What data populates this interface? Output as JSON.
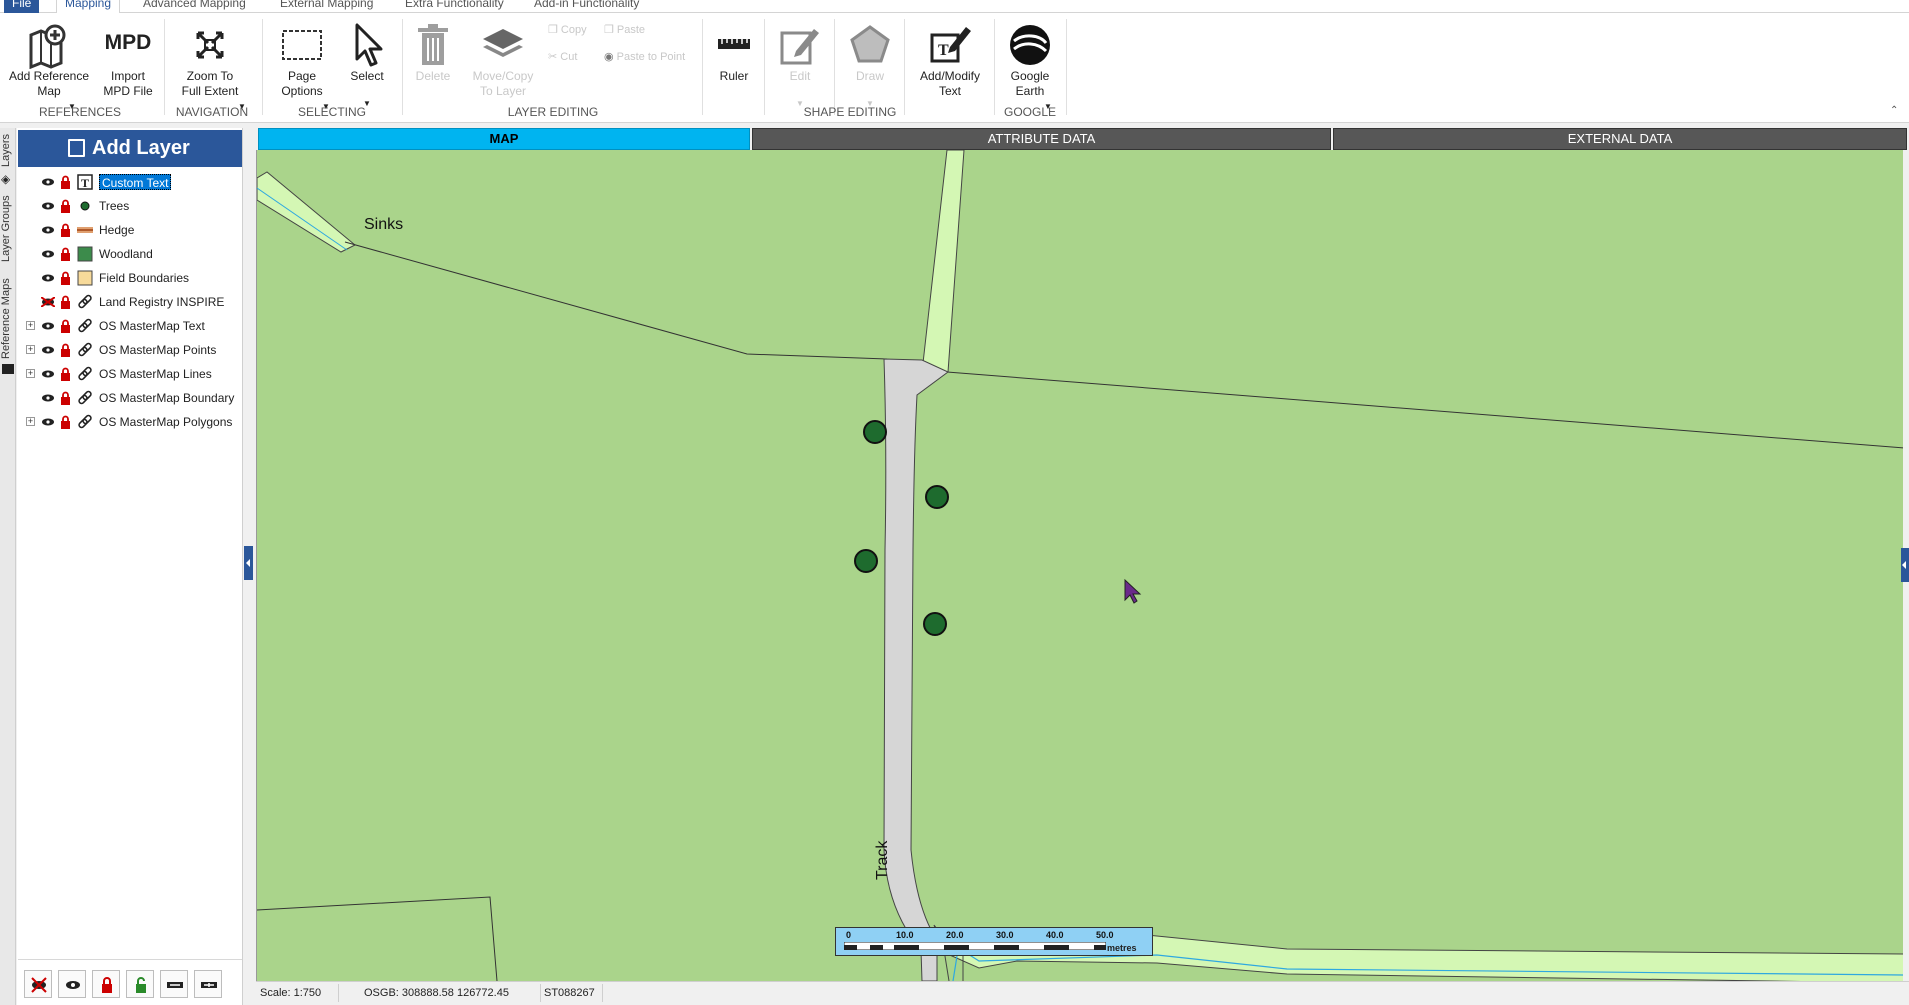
{
  "menu": {
    "tabs": [
      {
        "label": "File"
      },
      {
        "label": "Mapping"
      },
      {
        "label": "Advanced Mapping"
      },
      {
        "label": "External Mapping"
      },
      {
        "label": "Extra Functionality"
      },
      {
        "label": "Add-in Functionality"
      }
    ]
  },
  "ribbon": {
    "add_reference_map": "Add Reference\nMap",
    "import_mpd_icon_text": "MPD",
    "import_mpd": "Import\nMPD File",
    "zoom_full": "Zoom To\nFull Extent",
    "page_options": "Page\nOptions",
    "select": "Select",
    "delete": "Delete",
    "move_copy": "Move/Copy\nTo Layer",
    "copy": "Copy",
    "paste": "Paste",
    "cut": "Cut",
    "paste_to_point": "Paste to Point",
    "ruler": "Ruler",
    "edit": "Edit",
    "draw": "Draw",
    "add_modify_text": "Add/Modify\nText",
    "google_earth": "Google\nEarth",
    "groups": {
      "references": "REFERENCES",
      "navigation": "NAVIGATION",
      "selecting": "SELECTING",
      "layer_editing": "LAYER EDITING",
      "shape_editing": "SHAPE EDITING",
      "google": "GOOGLE"
    }
  },
  "sidetabs": {
    "layers": "Layers",
    "layer_groups": "Layer Groups",
    "reference_maps": "Reference Maps"
  },
  "layers_panel": {
    "add_layer": "Add Layer",
    "layers": [
      {
        "name": "Custom Text",
        "symbol": "text-icon",
        "selected": true
      },
      {
        "name": "Trees",
        "symbol": "point-symbol"
      },
      {
        "name": "Hedge",
        "symbol": "line-symbol"
      },
      {
        "name": "Woodland",
        "symbol": "polygon-symbol"
      },
      {
        "name": "Field Boundaries",
        "symbol": "polygon-symbol"
      },
      {
        "name": "Land Registry INSPIRE",
        "symbol": "link-icon",
        "hidden": true
      },
      {
        "name": "OS MasterMap Text",
        "symbol": "link-icon",
        "expandable": true
      },
      {
        "name": "OS MasterMap Points",
        "symbol": "link-icon",
        "expandable": true
      },
      {
        "name": "OS MasterMap Lines",
        "symbol": "link-icon",
        "expandable": true
      },
      {
        "name": "OS MasterMap Boundary",
        "symbol": "link-icon"
      },
      {
        "name": "OS MasterMap Polygons",
        "symbol": "link-icon",
        "expandable": true
      }
    ]
  },
  "view_tabs": {
    "map": "MAP",
    "attribute_data": "ATTRIBUTE DATA",
    "external_data": "EXTERNAL DATA"
  },
  "map": {
    "labels": {
      "sinks": "Sinks",
      "track": "Track"
    },
    "scalebar": {
      "ticks": [
        "0",
        "10.0",
        "20.0",
        "30.0",
        "40.0",
        "50.0"
      ],
      "unit": "metres"
    },
    "colors": {
      "field": "#aad48b",
      "road": "#d6d6d6",
      "hedge": "#d4f7b4",
      "tree": "#1e6b2e",
      "water": "#2ea8e0"
    }
  },
  "status": {
    "scale": "Scale: 1:750",
    "coords": "OSGB: 308888.58  126772.45",
    "grid_ref": "ST088267"
  }
}
